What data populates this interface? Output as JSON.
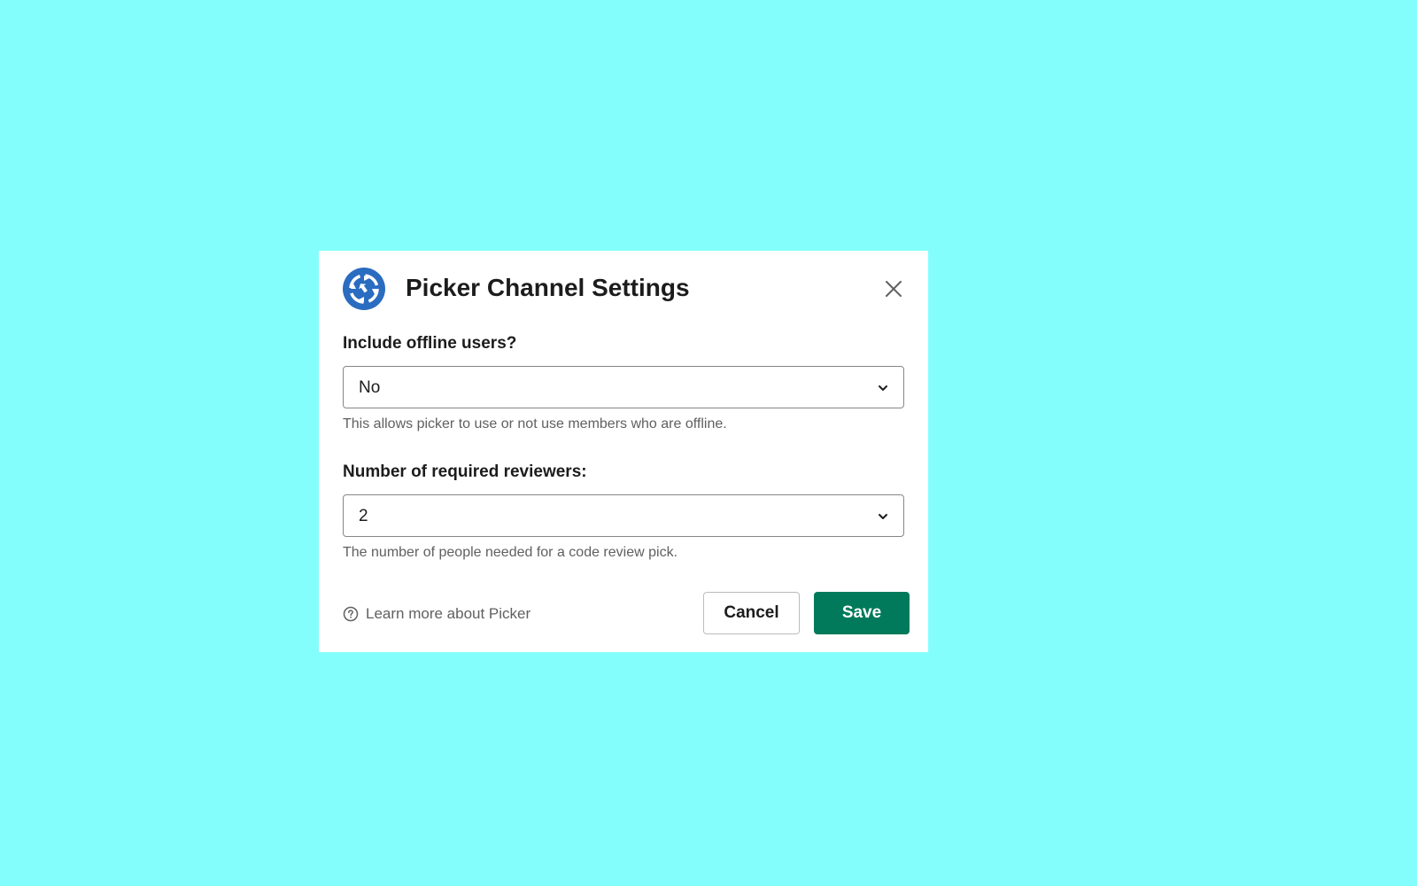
{
  "modal": {
    "title": "Picker Channel Settings",
    "logo_icon": "picker-logo-icon",
    "close_icon": "close-icon"
  },
  "fields": [
    {
      "label": "Include offline users?",
      "value": "No",
      "hint": "This allows picker to use or not use members who are offline."
    },
    {
      "label": "Number of required reviewers:",
      "value": "2",
      "hint": "The number of people needed for a code review pick."
    }
  ],
  "footer": {
    "learn_more": "Learn more about Picker",
    "help_icon": "help-circle-icon",
    "cancel_label": "Cancel",
    "save_label": "Save"
  },
  "colors": {
    "background": "#84fefd",
    "primary": "#007a5a",
    "logo": "#2a6cc0"
  }
}
